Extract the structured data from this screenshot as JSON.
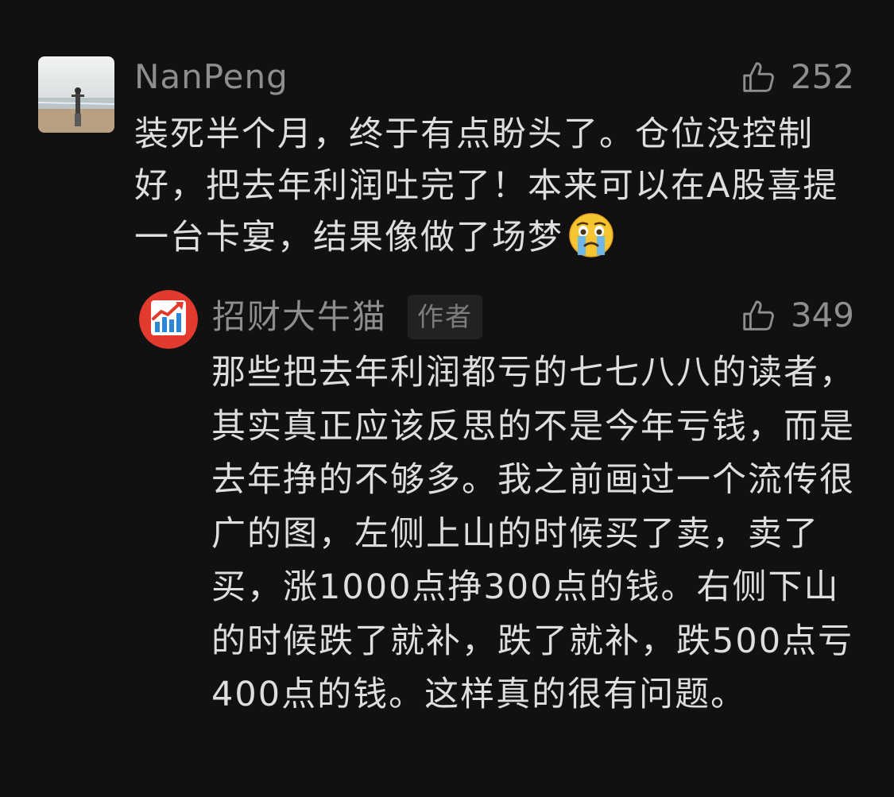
{
  "comment": {
    "username": "NanPeng",
    "likes": "252",
    "text": "装死半个月，终于有点盼头了。仓位没控制好，把去年利润吐完了！本来可以在A股喜提一台卡宴，结果像做了场梦",
    "emoji": "crying-face-emoji"
  },
  "reply": {
    "username": "招财大牛猫",
    "badge": "作者",
    "likes": "349",
    "text": "那些把去年利润都亏的七七八八的读者，其实真正应该反思的不是今年亏钱，而是去年挣的不够多。我之前画过一个流传很广的图，左侧上山的时候买了卖，卖了买，涨1000点挣300点的钱。右侧下山的时候跌了就补，跌了就补，跌500点亏400点的钱。这样真的很有问题。"
  },
  "icons": {
    "like": "thumbs-up-icon"
  },
  "colors": {
    "background": "#111111",
    "text": "#dedede",
    "muted": "#8e8e8e",
    "badge_bg": "#222222"
  }
}
